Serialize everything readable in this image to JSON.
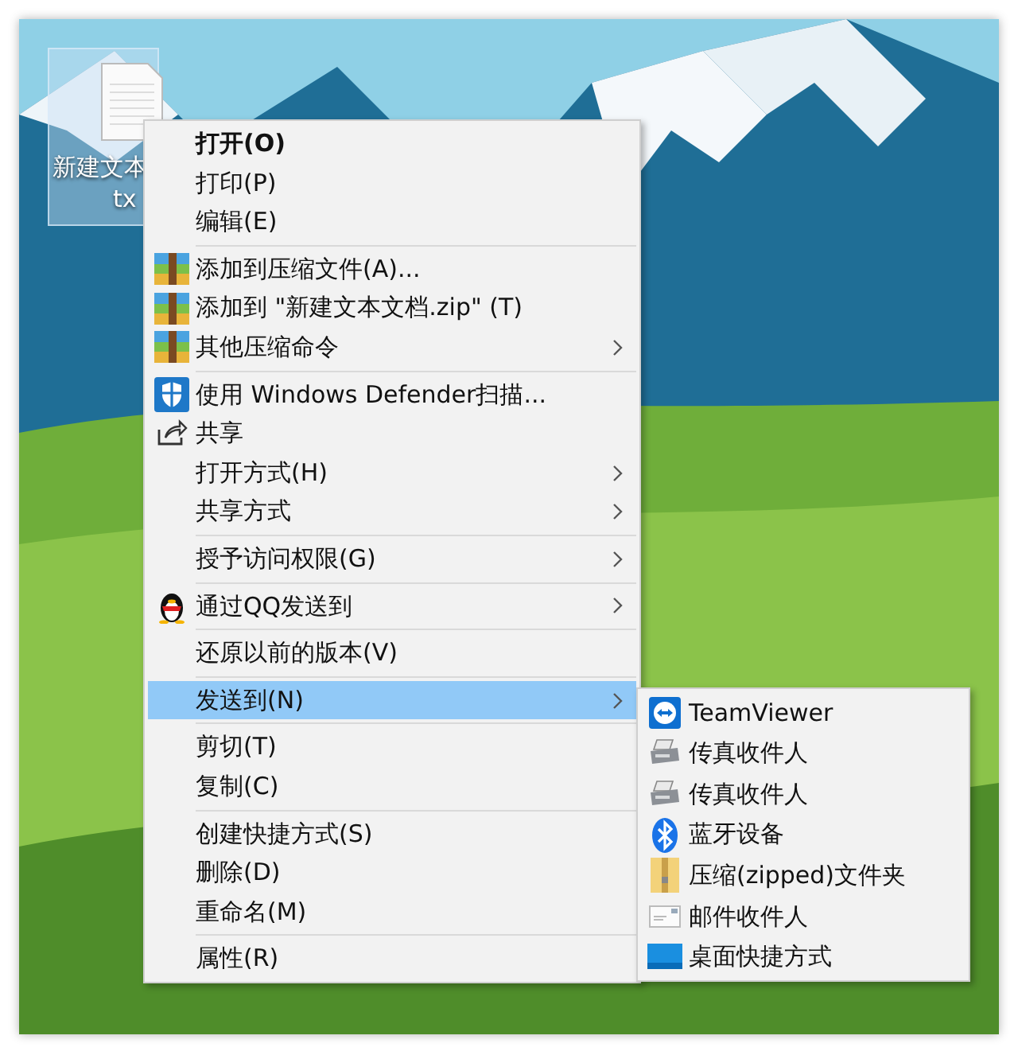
{
  "desktop_icon": {
    "label_line_1": "新建文本",
    "label_line_2": "tx",
    "selected": true
  },
  "context_menu": {
    "groups": [
      [
        {
          "label": "打开(O)",
          "default": true,
          "submenu": false,
          "selected": false
        },
        {
          "label": "打印(P)",
          "default": false,
          "submenu": false,
          "selected": false
        },
        {
          "label": "编辑(E)",
          "default": false,
          "submenu": false,
          "selected": false
        }
      ],
      [
        {
          "label": "添加到压缩文件(A)...",
          "default": false,
          "submenu": false,
          "selected": false
        },
        {
          "label": "添加到 \"新建文本文档.zip\" (T)",
          "default": false,
          "submenu": false,
          "selected": false
        },
        {
          "label": "其他压缩命令",
          "default": false,
          "submenu": true,
          "selected": false
        }
      ],
      [
        {
          "label": "使用 Windows Defender扫描...",
          "default": false,
          "submenu": false,
          "selected": false
        },
        {
          "label": "共享",
          "default": false,
          "submenu": false,
          "selected": false
        },
        {
          "label": "打开方式(H)",
          "default": false,
          "submenu": true,
          "selected": false
        },
        {
          "label": "共享方式",
          "default": false,
          "submenu": true,
          "selected": false
        }
      ],
      [
        {
          "label": "授予访问权限(G)",
          "default": false,
          "submenu": true,
          "selected": false
        }
      ],
      [
        {
          "label": "通过QQ发送到",
          "default": false,
          "submenu": true,
          "selected": false
        }
      ],
      [
        {
          "label": "还原以前的版本(V)",
          "default": false,
          "submenu": false,
          "selected": false
        }
      ],
      [
        {
          "label": "发送到(N)",
          "default": false,
          "submenu": true,
          "selected": true
        }
      ],
      [
        {
          "label": "剪切(T)",
          "default": false,
          "submenu": false,
          "selected": false
        },
        {
          "label": "复制(C)",
          "default": false,
          "submenu": false,
          "selected": false
        }
      ],
      [
        {
          "label": "创建快捷方式(S)",
          "default": false,
          "submenu": false,
          "selected": false
        },
        {
          "label": "删除(D)",
          "default": false,
          "submenu": false,
          "selected": false
        },
        {
          "label": "重命名(M)",
          "default": false,
          "submenu": false,
          "selected": false
        }
      ],
      [
        {
          "label": "属性(R)",
          "default": false,
          "submenu": false,
          "selected": false
        }
      ]
    ]
  },
  "send_to_submenu": {
    "items": [
      {
        "label": "TeamViewer"
      },
      {
        "label": "传真收件人"
      },
      {
        "label": "传真收件人"
      },
      {
        "label": "蓝牙设备"
      },
      {
        "label": "压缩(zipped)文件夹"
      },
      {
        "label": "邮件收件人"
      },
      {
        "label": "桌面快捷方式"
      }
    ]
  }
}
